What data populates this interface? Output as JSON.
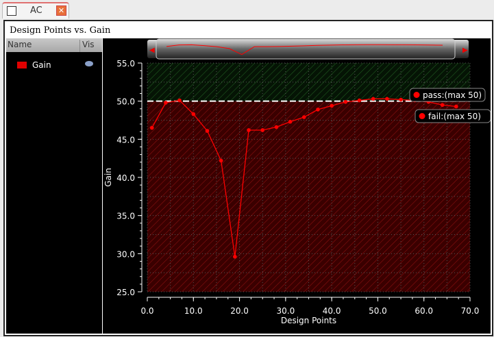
{
  "tab": {
    "label": "AC"
  },
  "window_title": "Design Points vs. Gain",
  "legend_panel": {
    "col_name": "Name",
    "col_vis": "Vis",
    "items": [
      {
        "label": "Gain",
        "color": "#e00000"
      }
    ]
  },
  "chart_data": {
    "type": "line",
    "xlabel": "Design Points",
    "ylabel": "Gain",
    "xlim": [
      0,
      70
    ],
    "ylim": [
      25,
      55
    ],
    "xticks": [
      "0.0",
      "10.0",
      "20.0",
      "30.0",
      "40.0",
      "50.0",
      "60.0",
      "70.0"
    ],
    "yticks": [
      "25.0",
      "30.0",
      "35.0",
      "40.0",
      "45.0",
      "50.0",
      "55.0"
    ],
    "threshold": 50,
    "annotations": {
      "pass": "pass:(max 50)",
      "fail": "fail:(max 50)"
    },
    "series": [
      {
        "name": "Gain",
        "color": "#ff0000",
        "x": [
          1,
          4,
          7,
          10,
          13,
          16,
          19,
          22,
          25,
          28,
          31,
          34,
          37,
          40,
          43,
          46,
          49,
          52,
          55,
          58,
          61,
          64,
          67
        ],
        "y": [
          46.5,
          49.8,
          50.1,
          48.3,
          46.1,
          42.2,
          29.6,
          46.2,
          46.2,
          46.6,
          47.3,
          47.9,
          48.9,
          49.4,
          49.9,
          50.1,
          50.3,
          50.3,
          50.2,
          50.1,
          49.9,
          49.5,
          49.3
        ]
      }
    ]
  }
}
